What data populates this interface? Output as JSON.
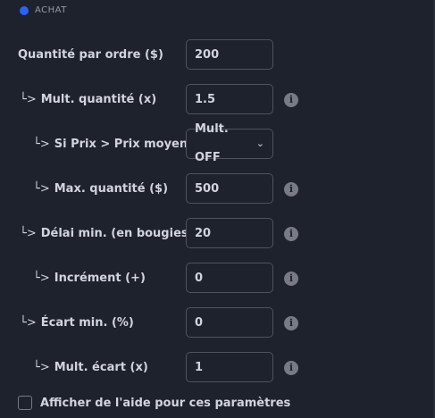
{
  "section": {
    "title": "ACHAT",
    "accent_color": "#2962ff"
  },
  "arrow": "└>",
  "rows": [
    {
      "label": "Quantité par ordre ($)",
      "value": "200"
    },
    {
      "label": "Mult. quantité (x)",
      "value": "1.5",
      "info": "i"
    },
    {
      "label": "Si Prix > Prix moyen",
      "value": "Mult. OFF"
    },
    {
      "label": "Max. quantité ($)",
      "value": "500",
      "info": "i"
    },
    {
      "label": "Délai min. (en bougies)",
      "value": "20",
      "info": "i"
    },
    {
      "label": "Incrément (+)",
      "value": "0",
      "info": "i"
    },
    {
      "label": "Écart min. (%)",
      "value": "0",
      "info": "i"
    },
    {
      "label": "Mult. écart (x)",
      "value": "1",
      "info": "i"
    }
  ],
  "help_checkbox": {
    "label": "Afficher de l'aide pour ces paramètres",
    "checked": false
  }
}
